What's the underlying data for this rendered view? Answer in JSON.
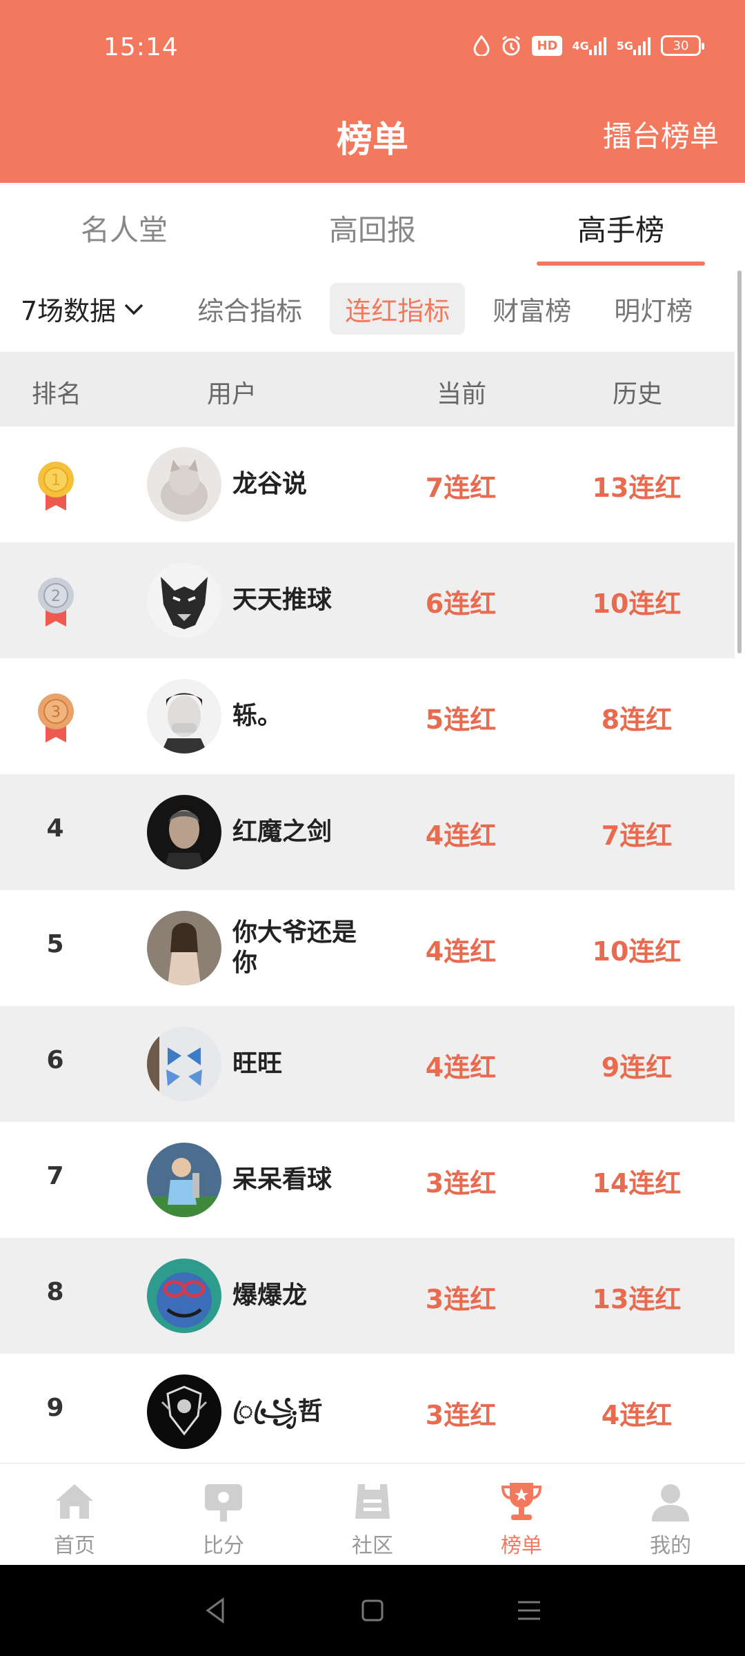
{
  "status_bar": {
    "time": "15:14",
    "hd_label": "HD",
    "net_4g": "4G",
    "net_5g": "5G",
    "battery": "30"
  },
  "header": {
    "title": "榜单",
    "action": "擂台榜单"
  },
  "tabs": [
    {
      "label": "名人堂"
    },
    {
      "label": "高回报"
    },
    {
      "label": "高手榜",
      "active": true
    }
  ],
  "filters": {
    "period": "7场数据",
    "chips": [
      "综合指标",
      "连红指标",
      "财富榜",
      "明灯榜"
    ],
    "active_chip": "连红指标"
  },
  "table": {
    "headers": {
      "rank": "排名",
      "user": "用户",
      "current": "当前",
      "history": "历史"
    },
    "rows": [
      {
        "rank": "1",
        "name": "龙谷说",
        "current": "7连红",
        "history": "13连红"
      },
      {
        "rank": "2",
        "name": "天天推球",
        "current": "6连红",
        "history": "10连红"
      },
      {
        "rank": "3",
        "name": "轹。",
        "current": "5连红",
        "history": "8连红"
      },
      {
        "rank": "4",
        "name": "红魔之剑",
        "current": "4连红",
        "history": "7连红"
      },
      {
        "rank": "5",
        "name": "你大爷还是你",
        "current": "4连红",
        "history": "10连红"
      },
      {
        "rank": "6",
        "name": "旺旺",
        "current": "4连红",
        "history": "9连红"
      },
      {
        "rank": "7",
        "name": "呆呆看球",
        "current": "3连红",
        "history": "14连红"
      },
      {
        "rank": "8",
        "name": "爆爆龙",
        "current": "3连红",
        "history": "13连红"
      },
      {
        "rank": "9",
        "name": "ꦿ꧁ꦿ哲",
        "current": "3连红",
        "history": "4连红"
      }
    ]
  },
  "bottom_nav": [
    {
      "label": "首页",
      "icon": "home-icon"
    },
    {
      "label": "比分",
      "icon": "score-icon"
    },
    {
      "label": "社区",
      "icon": "community-icon"
    },
    {
      "label": "榜单",
      "icon": "trophy-icon",
      "active": true
    },
    {
      "label": "我的",
      "icon": "profile-icon"
    }
  ],
  "colors": {
    "accent": "#F2795E",
    "streak_text": "#E86A4F",
    "gold": "#F5C13A",
    "silver": "#C9CFD8",
    "bronze": "#E9A36A",
    "ribbon": "#EE5A4F"
  }
}
